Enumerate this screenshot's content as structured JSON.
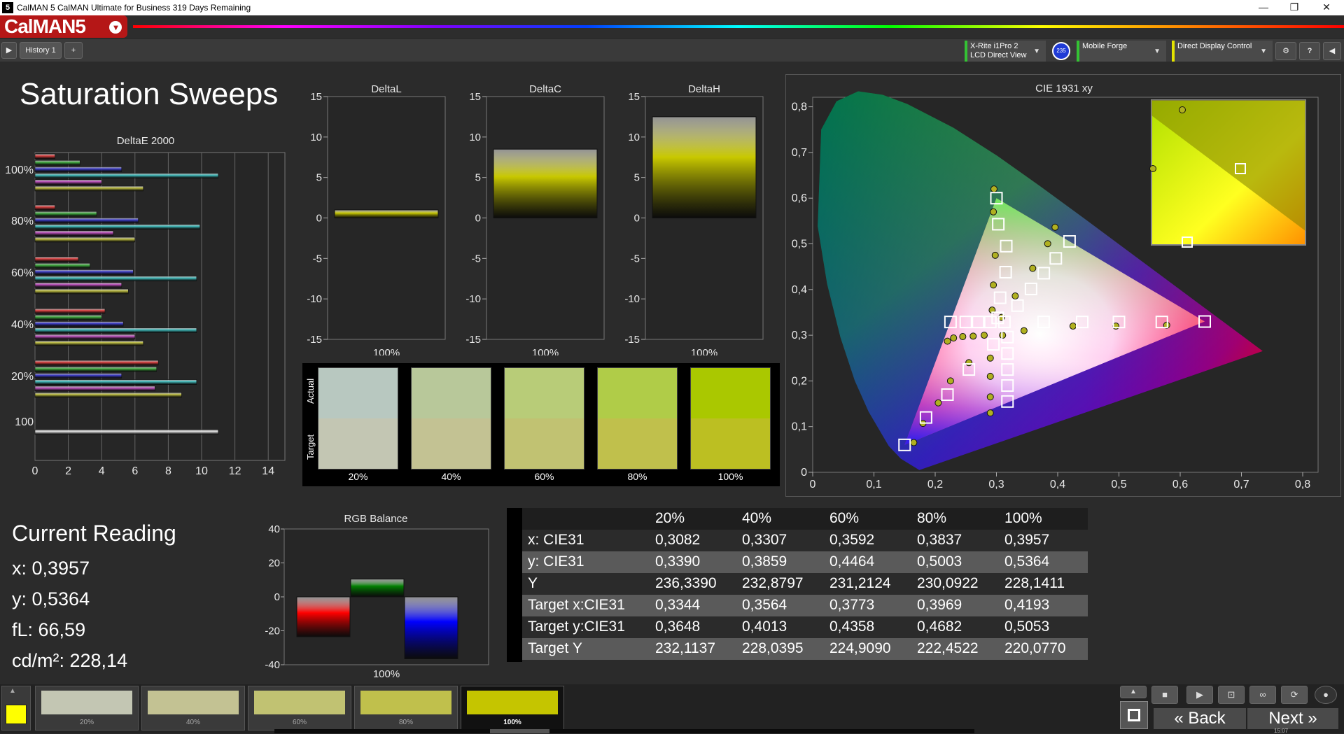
{
  "window": {
    "title": "CalMAN 5 CalMAN Ultimate for Business 319 Days Remaining",
    "app_icon": "5",
    "minimize": "—",
    "restore": "❐",
    "close": "✕"
  },
  "header": {
    "logo": "CalMAN5"
  },
  "tabs": {
    "active": "History 1",
    "add": "+"
  },
  "devices": {
    "meter_line1": "X-Rite i1Pro 2",
    "meter_line2": "LCD Direct View",
    "meter_badge": "235",
    "source": "Mobile Forge",
    "display": "Direct Display Control"
  },
  "page": {
    "title": "Saturation Sweeps"
  },
  "deltae_chart": {
    "title": "DeltaE 2000",
    "y_labels": [
      "100%",
      "80%",
      "60%",
      "40%",
      "20%",
      "100"
    ],
    "x_ticks": [
      "0",
      "2",
      "4",
      "6",
      "8",
      "10",
      "12",
      "14"
    ]
  },
  "chart_data": [
    {
      "type": "bar",
      "title": "DeltaE 2000",
      "orientation": "horizontal",
      "categories": [
        "100%",
        "80%",
        "60%",
        "40%",
        "20%",
        "100"
      ],
      "series": [
        {
          "color": "#e04040",
          "values": [
            1.2,
            1.2,
            2.6,
            4.2,
            7.4,
            null
          ]
        },
        {
          "color": "#40b040",
          "values": [
            2.7,
            3.7,
            3.3,
            4.0,
            7.3,
            null
          ]
        },
        {
          "color": "#4040d0",
          "values": [
            5.2,
            6.2,
            5.9,
            5.3,
            5.2,
            null
          ]
        },
        {
          "color": "#40c0c0",
          "values": [
            11.0,
            9.9,
            9.7,
            9.7,
            9.7,
            null
          ]
        },
        {
          "color": "#c050c0",
          "values": [
            4.0,
            4.7,
            5.2,
            6.0,
            7.2,
            null
          ]
        },
        {
          "color": "#c0c040",
          "values": [
            6.5,
            6.0,
            5.6,
            6.5,
            8.8,
            null
          ]
        },
        {
          "color": "#e0e0e0",
          "values": [
            null,
            null,
            null,
            null,
            null,
            11.0
          ]
        }
      ],
      "xlim": [
        0,
        15
      ]
    },
    {
      "type": "bar",
      "title": "DeltaL",
      "categories": [
        "100%"
      ],
      "values": [
        1.0
      ],
      "ylim": [
        -15,
        15
      ],
      "yticks": [
        "15",
        "10",
        "5",
        "0",
        "-5",
        "-10",
        "-15"
      ]
    },
    {
      "type": "bar",
      "title": "DeltaC",
      "categories": [
        "100%"
      ],
      "values": [
        8.5
      ],
      "ylim": [
        -15,
        15
      ],
      "yticks": [
        "15",
        "10",
        "5",
        "0",
        "-5",
        "-10",
        "-15"
      ]
    },
    {
      "type": "bar",
      "title": "DeltaH",
      "categories": [
        "100%"
      ],
      "values": [
        12.5
      ],
      "ylim": [
        -15,
        15
      ],
      "yticks": [
        "15",
        "10",
        "5",
        "0",
        "-5",
        "-10",
        "-15"
      ]
    },
    {
      "type": "bar",
      "title": "RGB Balance",
      "categories": [
        "100%"
      ],
      "series": [
        {
          "color": "#ff0000",
          "values": [
            -23.5
          ]
        },
        {
          "color": "#008000",
          "values": [
            10.5
          ]
        },
        {
          "color": "#0000ff",
          "values": [
            -36.5
          ]
        }
      ],
      "ylim": [
        -40,
        40
      ],
      "yticks": [
        "40",
        "20",
        "0",
        "-20",
        "-40"
      ]
    },
    {
      "type": "scatter",
      "title": "CIE 1931 xy",
      "xlim": [
        0,
        0.8
      ],
      "ylim": [
        0,
        0.8
      ],
      "xticks": [
        "0",
        "0,1",
        "0,2",
        "0,3",
        "0,4",
        "0,5",
        "0,6",
        "0,7",
        "0,8"
      ],
      "yticks": [
        "0",
        "0,1",
        "0,2",
        "0,3",
        "0,4",
        "0,5",
        "0,6",
        "0,7",
        "0,8"
      ],
      "target_points": [
        [
          0.313,
          0.329
        ],
        [
          0.3344,
          0.3648
        ],
        [
          0.3564,
          0.4013
        ],
        [
          0.3773,
          0.4358
        ],
        [
          0.3969,
          0.4682
        ],
        [
          0.4193,
          0.5053
        ],
        [
          0.302,
          0.338
        ],
        [
          0.306,
          0.382
        ],
        [
          0.315,
          0.438
        ],
        [
          0.316,
          0.495
        ],
        [
          0.303,
          0.543
        ],
        [
          0.3,
          0.6
        ],
        [
          0.377,
          0.329
        ],
        [
          0.44,
          0.329
        ],
        [
          0.5,
          0.329
        ],
        [
          0.57,
          0.329
        ],
        [
          0.64,
          0.33
        ],
        [
          0.318,
          0.296
        ],
        [
          0.318,
          0.26
        ],
        [
          0.318,
          0.225
        ],
        [
          0.318,
          0.19
        ],
        [
          0.318,
          0.155
        ],
        [
          0.29,
          0.329
        ],
        [
          0.27,
          0.329
        ],
        [
          0.25,
          0.329
        ],
        [
          0.225,
          0.329
        ],
        [
          0.295,
          0.28
        ],
        [
          0.255,
          0.225
        ],
        [
          0.22,
          0.17
        ],
        [
          0.185,
          0.12
        ],
        [
          0.15,
          0.06
        ]
      ],
      "measured_points": [
        [
          0.3082,
          0.339
        ],
        [
          0.3307,
          0.3859
        ],
        [
          0.3592,
          0.4464
        ],
        [
          0.3837,
          0.5003
        ],
        [
          0.3957,
          0.5364
        ],
        [
          0.293,
          0.355
        ],
        [
          0.295,
          0.41
        ],
        [
          0.298,
          0.475
        ],
        [
          0.295,
          0.57
        ],
        [
          0.296,
          0.62
        ],
        [
          0.345,
          0.31
        ],
        [
          0.425,
          0.32
        ],
        [
          0.495,
          0.32
        ],
        [
          0.578,
          0.322
        ],
        [
          0.31,
          0.3
        ],
        [
          0.29,
          0.25
        ],
        [
          0.29,
          0.21
        ],
        [
          0.29,
          0.165
        ],
        [
          0.29,
          0.13
        ],
        [
          0.28,
          0.3
        ],
        [
          0.262,
          0.298
        ],
        [
          0.245,
          0.297
        ],
        [
          0.23,
          0.294
        ],
        [
          0.22,
          0.287
        ],
        [
          0.255,
          0.24
        ],
        [
          0.225,
          0.2
        ],
        [
          0.205,
          0.152
        ],
        [
          0.18,
          0.107
        ],
        [
          0.165,
          0.065
        ]
      ],
      "inset_points": [
        [
          0.6,
          0.8
        ],
        [
          0.0,
          0.5
        ]
      ]
    }
  ],
  "deltas": {
    "dl_title": "DeltaL",
    "dc_title": "DeltaC",
    "dh_title": "DeltaH",
    "xlabel": "100%"
  },
  "swatches": {
    "actual_label": "Actual",
    "target_label": "Target",
    "items": [
      {
        "label": "20%",
        "actual": "#b8c8c0",
        "target": "#c3c6b3"
      },
      {
        "label": "40%",
        "actual": "#b8c89a",
        "target": "#c3c293"
      },
      {
        "label": "60%",
        "actual": "#b8cc78",
        "target": "#c1c272"
      },
      {
        "label": "80%",
        "actual": "#b0cc48",
        "target": "#c0c04c"
      },
      {
        "label": "100%",
        "actual": "#aac800",
        "target": "#bcbf22"
      }
    ]
  },
  "cie": {
    "title": "CIE 1931 xy"
  },
  "current": {
    "title": "Current Reading",
    "x": "x: 0,3957",
    "y": "y: 0,5364",
    "fl": "fL: 66,59",
    "cd": "cd/m²: 228,14"
  },
  "rgb": {
    "title": "RGB Balance",
    "xlabel": "100%"
  },
  "table": {
    "headers": [
      "",
      "20%",
      "40%",
      "60%",
      "80%",
      "100%"
    ],
    "rows": [
      [
        "x: CIE31",
        "0,3082",
        "0,3307",
        "0,3592",
        "0,3837",
        "0,3957"
      ],
      [
        "y: CIE31",
        "0,3390",
        "0,3859",
        "0,4464",
        "0,5003",
        "0,5364"
      ],
      [
        "Y",
        "236,3390",
        "232,8797",
        "231,2124",
        "230,0922",
        "228,1411"
      ],
      [
        "Target x:CIE31",
        "0,3344",
        "0,3564",
        "0,3773",
        "0,3969",
        "0,4193"
      ],
      [
        "Target y:CIE31",
        "0,3648",
        "0,4013",
        "0,4358",
        "0,4682",
        "0,5053"
      ],
      [
        "Target Y",
        "232,1137",
        "228,0395",
        "224,9090",
        "222,4522",
        "220,0770"
      ]
    ]
  },
  "bottom": {
    "active_color": "#ffff00",
    "swatches": [
      {
        "label": "20%",
        "color": "#c3c6b3"
      },
      {
        "label": "40%",
        "color": "#c3c293"
      },
      {
        "label": "60%",
        "color": "#c1c272"
      },
      {
        "label": "80%",
        "color": "#c0c04c"
      },
      {
        "label": "100%",
        "color": "#c5c500"
      }
    ],
    "back": "Back",
    "next": "Next",
    "time": "15:07"
  }
}
